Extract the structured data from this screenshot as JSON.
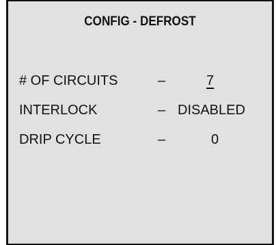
{
  "screen": {
    "title": "CONFIG - DEFROST",
    "settings": [
      {
        "label": "# OF CIRCUITS",
        "separator": "–",
        "value": "7",
        "selected": true
      },
      {
        "label": "INTERLOCK",
        "separator": "–",
        "value": "DISABLED",
        "selected": false
      },
      {
        "label": "DRIP CYCLE",
        "separator": "–",
        "value": "0",
        "selected": false
      }
    ]
  }
}
